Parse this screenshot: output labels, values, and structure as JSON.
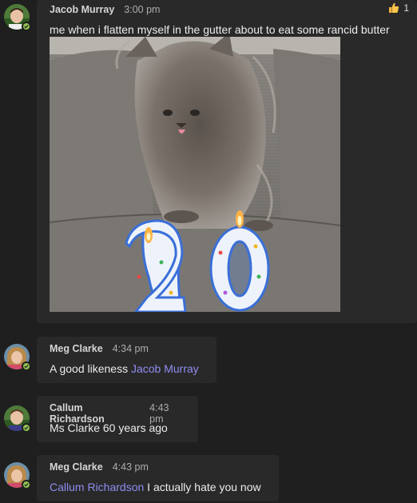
{
  "messages": [
    {
      "author": "Jacob Murray",
      "time": "3:00 pm",
      "text": "me when i flatten myself in the gutter about to eat some rancid butter",
      "reaction_count": "1",
      "reaction_icon": "thumbs-up-icon"
    },
    {
      "author": "Meg Clarke",
      "time": "4:34 pm",
      "text": "A good likeness ",
      "mention": "Jacob Murray"
    },
    {
      "author": "Callum Richardson",
      "time": "4:43 pm",
      "text": "Ms Clarke 60 years ago"
    },
    {
      "author": "Meg Clarke",
      "time": "4:43 pm",
      "mention": "Callum Richardson",
      "text": " I actually hate you now"
    }
  ],
  "colors": {
    "background": "#1f1f1f",
    "bubble": "#292929",
    "mention": "#8f8df0",
    "presence": "#92c353"
  }
}
